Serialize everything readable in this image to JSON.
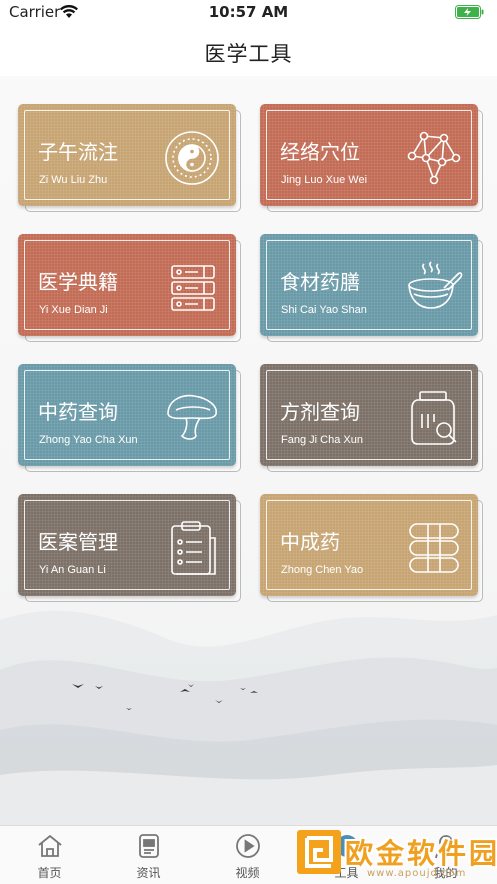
{
  "status_bar": {
    "carrier": "Carrier",
    "time": "10:57 AM"
  },
  "header": {
    "title": "医学工具"
  },
  "tools": [
    {
      "name": "子午流注",
      "pinyin": "Zi Wu Liu Zhu",
      "color": "#c7a573",
      "icon": "yin-yang-icon"
    },
    {
      "name": "经络穴位",
      "pinyin": "Jing Luo Xue Wei",
      "color": "#c26c55",
      "icon": "meridian-nodes-icon"
    },
    {
      "name": "医学典籍",
      "pinyin": "Yi Xue Dian Ji",
      "color": "#c26c55",
      "icon": "books-stack-icon"
    },
    {
      "name": "食材药膳",
      "pinyin": "Shi Cai Yao Shan",
      "color": "#6a9aa8",
      "icon": "soup-bowl-icon"
    },
    {
      "name": "中药查询",
      "pinyin": "Zhong Yao Cha Xun",
      "color": "#6a9aa8",
      "icon": "mushroom-icon"
    },
    {
      "name": "方剂查询",
      "pinyin": "Fang Ji Cha Xun",
      "color": "#7d7167",
      "icon": "jar-search-icon"
    },
    {
      "name": "医案管理",
      "pinyin": "Yi An Guan Li",
      "color": "#7d7167",
      "icon": "clipboard-icon"
    },
    {
      "name": "中成药",
      "pinyin": "Zhong Chen Yao",
      "color": "#c7a573",
      "icon": "capsules-icon"
    }
  ],
  "tab_bar": {
    "items": [
      {
        "label": "首页",
        "icon": "home-icon"
      },
      {
        "label": "资讯",
        "icon": "news-icon"
      },
      {
        "label": "视频",
        "icon": "video-play-icon"
      },
      {
        "label": "工具",
        "icon": "tools-icon"
      },
      {
        "label": "我的",
        "icon": "profile-icon"
      }
    ]
  },
  "watermark": {
    "text": "欧金软件园",
    "url": "www.apoujd.com"
  }
}
